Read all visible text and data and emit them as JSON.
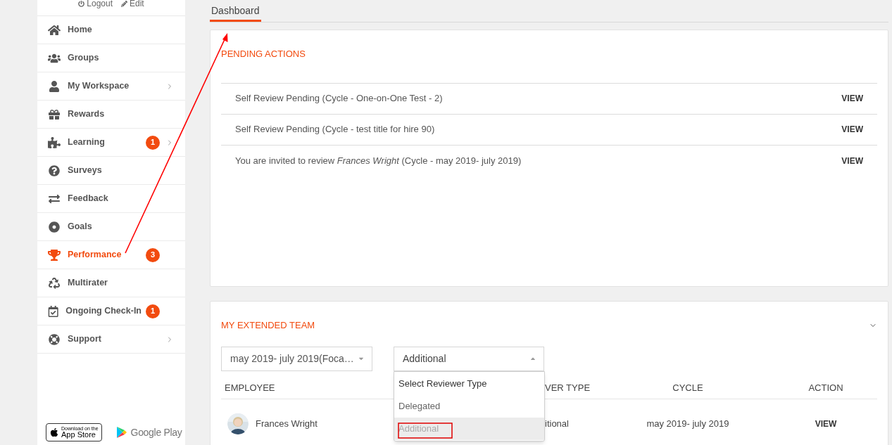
{
  "sidebar": {
    "header_links": [
      {
        "label": "Logout"
      },
      {
        "label": "Edit"
      }
    ],
    "items": [
      {
        "label": "Home",
        "selected": false,
        "submenu": false
      },
      {
        "label": "Groups",
        "selected": false,
        "submenu": false
      },
      {
        "label": "My Workspace",
        "selected": false,
        "submenu": true
      },
      {
        "label": "Rewards",
        "selected": false,
        "submenu": false
      },
      {
        "label": "Learning",
        "selected": false,
        "submenu": true,
        "badge": "1"
      },
      {
        "label": "Surveys",
        "selected": false,
        "submenu": false
      },
      {
        "label": "Feedback",
        "selected": false,
        "submenu": false
      },
      {
        "label": "Goals",
        "selected": false,
        "submenu": false
      },
      {
        "label": "Performance",
        "selected": true,
        "submenu": false,
        "badge": "3"
      },
      {
        "label": "Multirater",
        "selected": false,
        "submenu": false
      },
      {
        "label": "Ongoing Check-In",
        "selected": false,
        "submenu": false,
        "badge": "1"
      },
      {
        "label": "Support",
        "selected": false,
        "submenu": true
      }
    ],
    "app_badges": {
      "app_store_caption": "Download on the",
      "app_store": "App Store",
      "google_play": "Google Play"
    }
  },
  "tabs": [
    {
      "label": "Dashboard",
      "selected": true
    }
  ],
  "pending_actions": {
    "title": "PENDING ACTIONS",
    "items": [
      {
        "text": "Self Review Pending (Cycle - One-on-One Test - 2)",
        "action": "VIEW"
      },
      {
        "text": "Self Review Pending (Cycle - test title for hire 90)",
        "action": "VIEW"
      },
      {
        "text": "You are invited to review *Frances Wright* (Cycle - may 2019- july 2019)",
        "action": "VIEW"
      }
    ]
  },
  "extended_team": {
    "title": "MY EXTENDED TEAM",
    "cycle_select": {
      "value": "may 2019- july 2019(Foca…"
    },
    "reviewer_select": {
      "value": "Additional",
      "open": true,
      "options": [
        {
          "label": "Select Reviewer Type",
          "kind": "prompt",
          "selected": false
        },
        {
          "label": "Delegated",
          "kind": "option",
          "selected": false
        },
        {
          "label": "Additional",
          "kind": "option",
          "selected": true
        }
      ]
    },
    "table": {
      "columns": [
        "EMPLOYEE",
        "VER TYPE",
        "CYCLE",
        "ACTION"
      ],
      "rows": [
        {
          "employee": "Frances Wright",
          "reviewer_type": "itional",
          "cycle": "may 2019- july 2019",
          "action": "VIEW"
        }
      ]
    }
  }
}
